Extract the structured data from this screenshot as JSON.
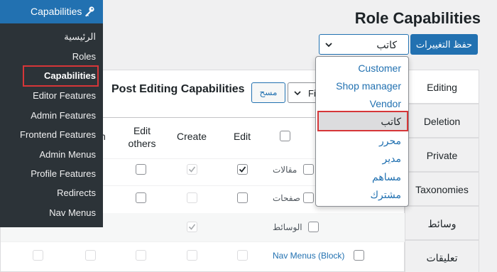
{
  "sidebar": {
    "header_label": "Capabilities",
    "items": [
      {
        "label": "الرئيسية"
      },
      {
        "label": "Roles"
      },
      {
        "label": "Capabilities"
      },
      {
        "label": "Editor Features"
      },
      {
        "label": "Admin Features"
      },
      {
        "label": "Frontend Features"
      },
      {
        "label": "Admin Menus"
      },
      {
        "label": "Profile Features"
      },
      {
        "label": "Redirects"
      },
      {
        "label": "Nav Menus"
      }
    ]
  },
  "header": {
    "title": "Role Capabilities"
  },
  "toolbar": {
    "role_value": "كاتب",
    "save_label": "حفظ التغييرات"
  },
  "dropdown": {
    "options": [
      "Customer",
      "Shop manager",
      "Vendor",
      "كاتب",
      "محرر",
      "مدير",
      "مساهم",
      "مشترك"
    ],
    "selected": "كاتب"
  },
  "panel": {
    "title": "Post Editing Capabilities",
    "clear_label": "مسح",
    "filter_value": "Fi",
    "columns": {
      "partial": "n",
      "edit_others": "Edit others",
      "create": "Create",
      "edit": "Edit"
    },
    "rows": [
      {
        "label": "مقالات",
        "create": true,
        "edit": true
      },
      {
        "label": "صفحات",
        "create": false,
        "edit": false
      },
      {
        "label": "الوسائط",
        "create": true,
        "edit": false
      },
      {
        "label": "Nav Menus (Block)",
        "create": false,
        "edit": false
      }
    ]
  },
  "tabs": [
    {
      "label": "Editing",
      "active": true
    },
    {
      "label": "Deletion",
      "active": false
    },
    {
      "label": "Private",
      "active": false
    },
    {
      "label": "Taxonomies",
      "active": false
    },
    {
      "label": "وسائط",
      "active": false
    },
    {
      "label": "تعليقات",
      "active": false
    }
  ],
  "colors": {
    "accent": "#2271b1",
    "highlight": "#d63638",
    "sidebar_bg": "#2c3338"
  }
}
